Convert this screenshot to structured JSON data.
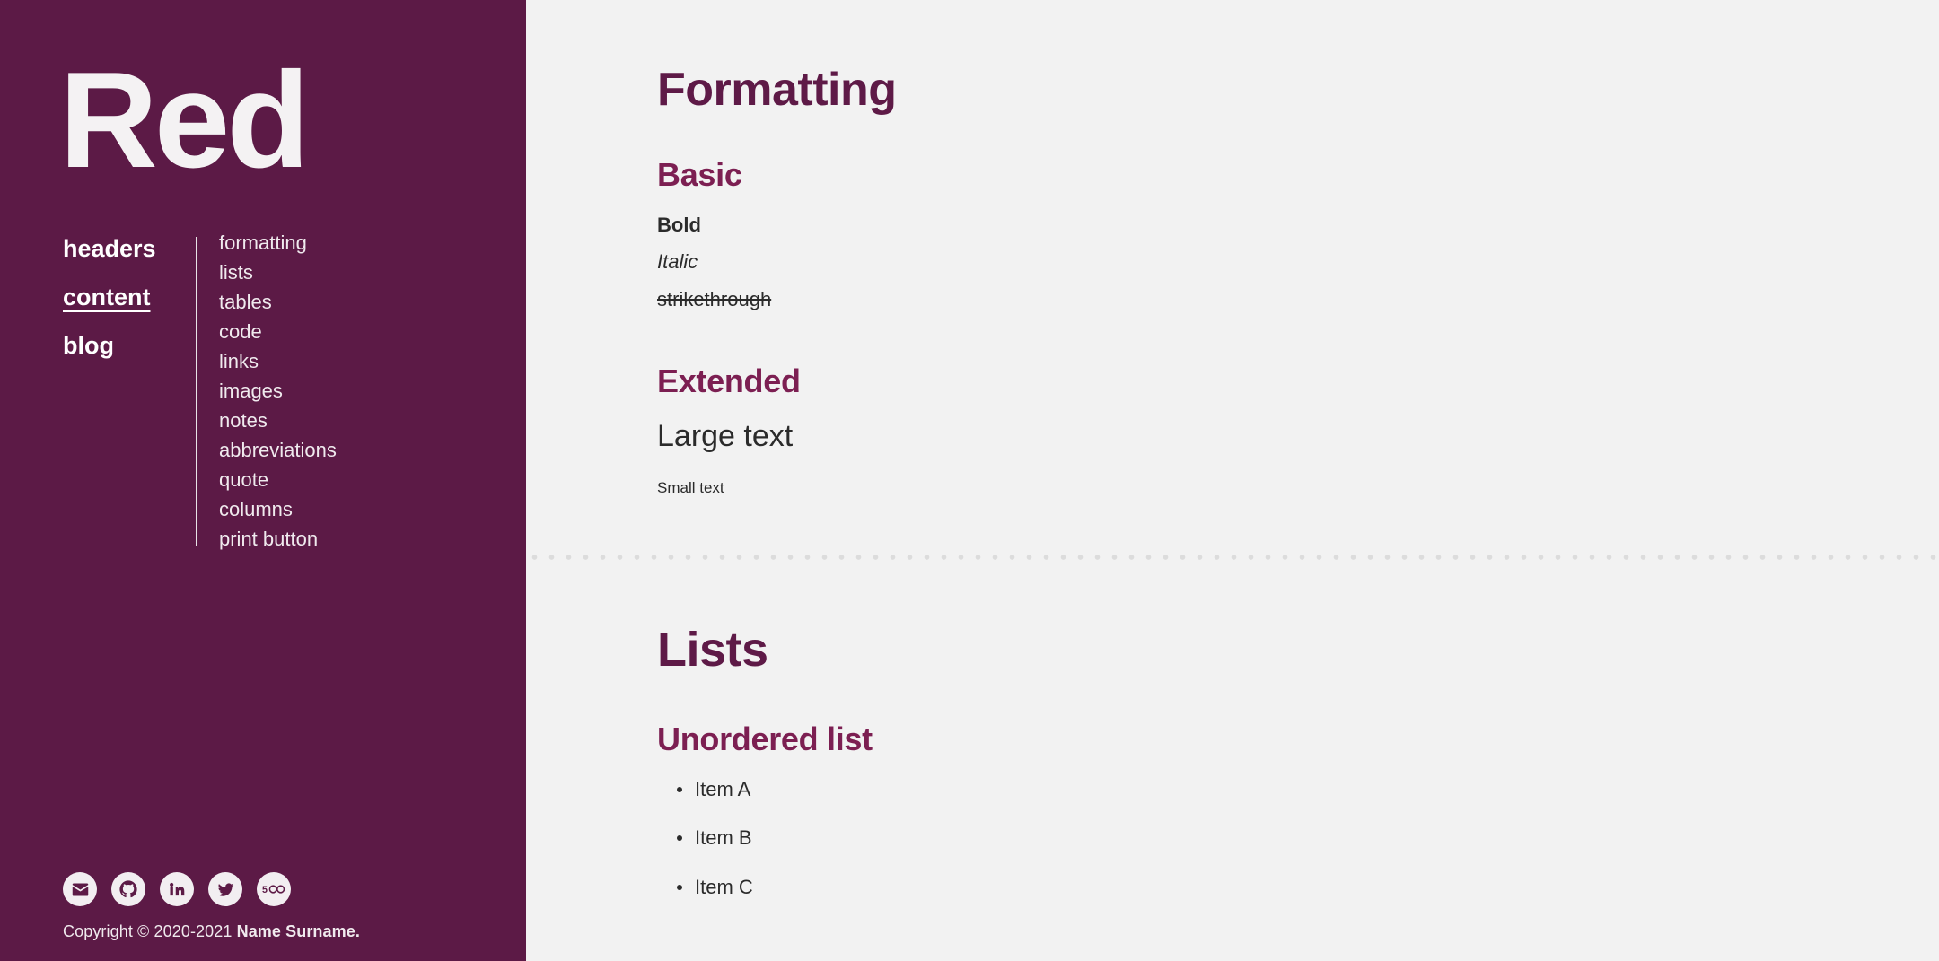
{
  "sidebar": {
    "brand": "Red",
    "nav_primary": [
      {
        "label": "headers",
        "active": false
      },
      {
        "label": "content",
        "active": true
      },
      {
        "label": "blog",
        "active": false
      }
    ],
    "nav_secondary": [
      {
        "label": "formatting"
      },
      {
        "label": "lists"
      },
      {
        "label": "tables"
      },
      {
        "label": "code"
      },
      {
        "label": "links"
      },
      {
        "label": "images"
      },
      {
        "label": "notes"
      },
      {
        "label": "abbreviations"
      },
      {
        "label": "quote"
      },
      {
        "label": "columns"
      },
      {
        "label": "print button"
      }
    ],
    "socials": [
      {
        "name": "email-icon",
        "title": "Email"
      },
      {
        "name": "github-icon",
        "title": "GitHub"
      },
      {
        "name": "linkedin-icon",
        "title": "LinkedIn"
      },
      {
        "name": "twitter-icon",
        "title": "Twitter"
      },
      {
        "name": "fivehundredpx-icon",
        "title": "500px"
      }
    ],
    "copyright_prefix": "Copyright © 2020-2021 ",
    "copyright_name": "Name Surname."
  },
  "main": {
    "formatting": {
      "title": "Formatting",
      "basic_title": "Basic",
      "bold": "Bold",
      "italic": "Italic",
      "strikethrough": "strikethrough",
      "extended_title": "Extended",
      "large_text": "Large text",
      "small_text": "Small text"
    },
    "lists": {
      "title": "Lists",
      "unordered_title": "Unordered list",
      "items": [
        "Item A",
        "Item B",
        "Item C"
      ]
    }
  },
  "colors": {
    "sidebar_bg": "#5c1a46",
    "page_bg": "#f2f2f2",
    "heading": "#5e1a47",
    "subheading": "#7c1f52",
    "body_text": "#2b2b2b",
    "divider_dot": "#dcdcdc"
  }
}
